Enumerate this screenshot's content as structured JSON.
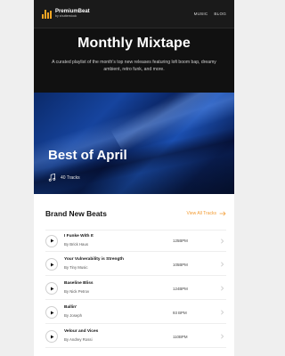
{
  "header": {
    "brand_name": "PremiumBeat",
    "brand_sub": "by shutterstock",
    "nav": [
      "MUSIC",
      "BLOG"
    ]
  },
  "hero": {
    "title": "Monthly Mixtape",
    "description": "A curated playlist of the month's top new releases featuring lofi boom bap, dreamy ambient, retro funk, and more."
  },
  "banner": {
    "title": "Best of April",
    "tracks_count": "40 Tracks",
    "icon": "music-note-icon"
  },
  "tracks_section": {
    "title": "Brand New Beats",
    "view_all_label": "View All Tracks",
    "accent_color": "#f39c33",
    "items": [
      {
        "name": "I Funke With It",
        "artist": "By Brick Haus",
        "bpm": "125BPM"
      },
      {
        "name": "Your Vulnerability is Strength",
        "artist": "By Tiny Music",
        "bpm": "105BPM"
      },
      {
        "name": "Baseline Bliss",
        "artist": "By Nick Petrov",
        "bpm": "124BPM"
      },
      {
        "name": "Ballin'",
        "artist": "By Joseph",
        "bpm": "93 BPM"
      },
      {
        "name": "Velour and Vices",
        "artist": "By Andrey Rossi",
        "bpm": "110BPM"
      }
    ]
  }
}
